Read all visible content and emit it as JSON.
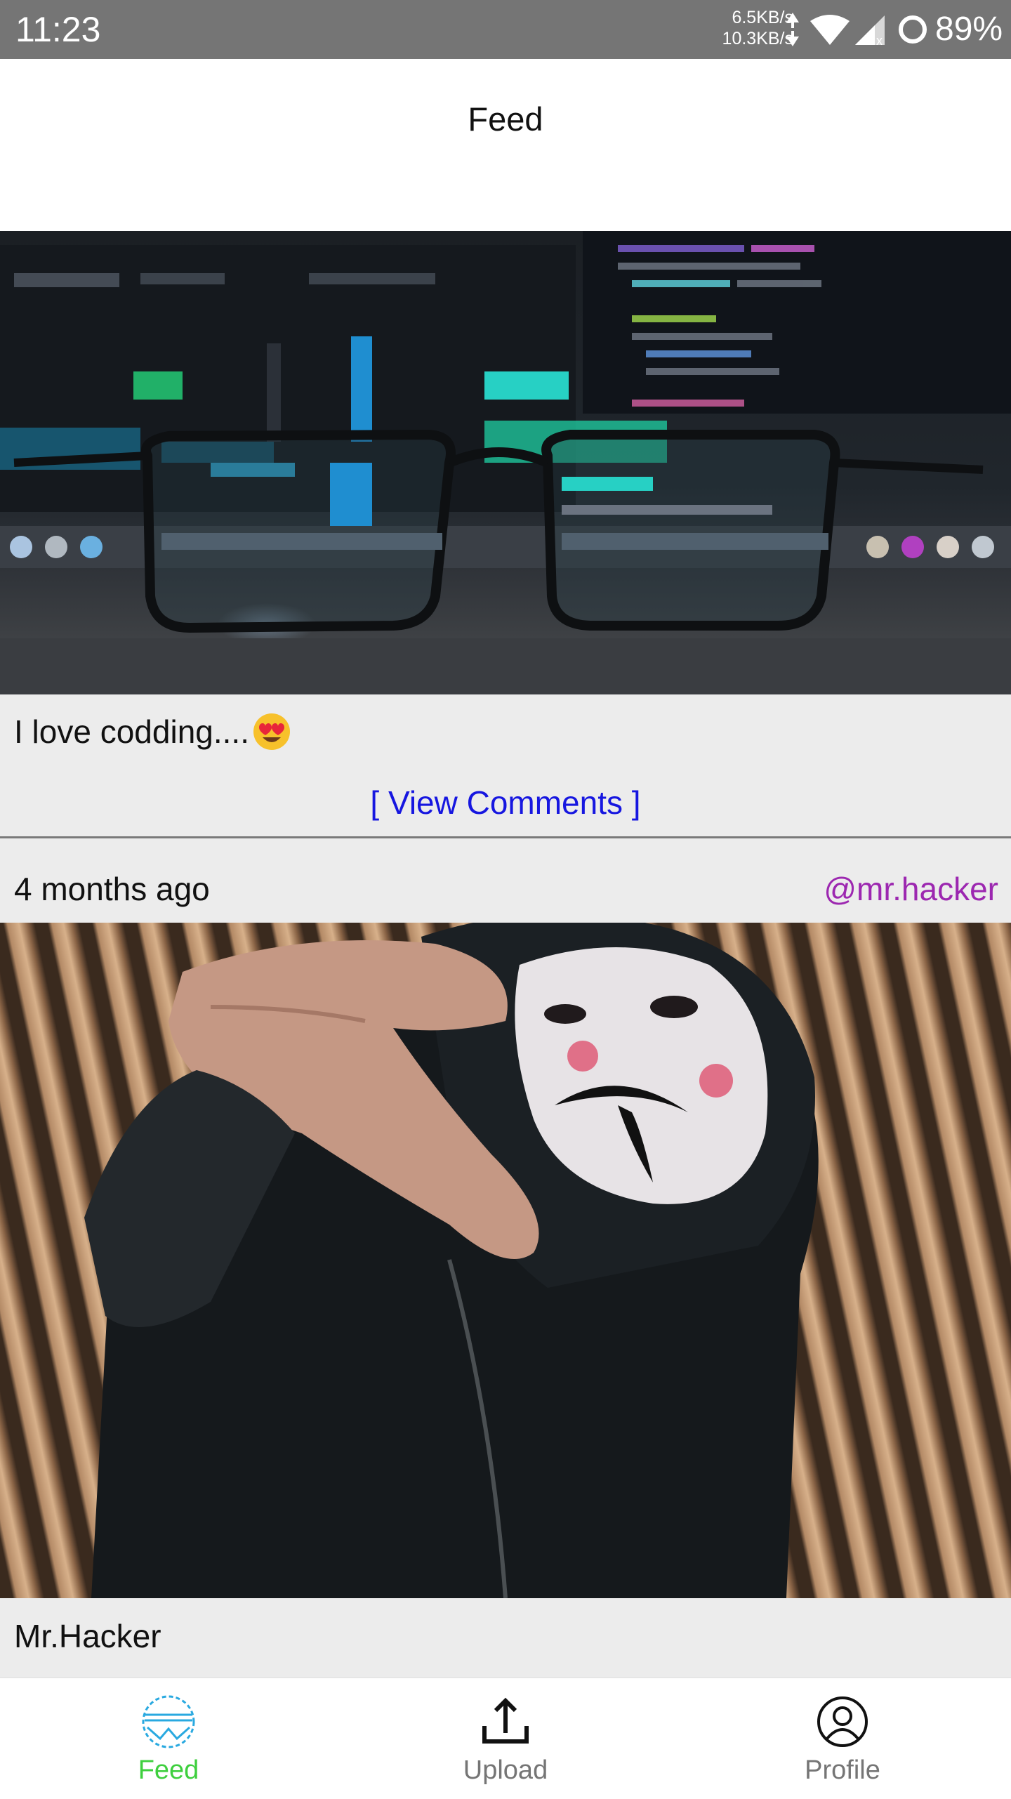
{
  "status_bar": {
    "time": "11:23",
    "net_down": "6.5KB/s",
    "net_up": "10.3KB/s",
    "battery": "89%"
  },
  "header": {
    "title": "Feed"
  },
  "posts": [
    {
      "image_desc": "eyeglasses in front of code monitor",
      "caption": "I love codding....",
      "emoji": "heart-eyes-emoji",
      "view_comments": "[ View Comments ]"
    },
    {
      "timestamp": "4 months ago",
      "username": "@mr.hacker",
      "image_desc": "person in mask reaching toward camera",
      "caption": "Mr.Hacker"
    }
  ],
  "bottom_nav": {
    "items": [
      {
        "label": "Feed",
        "icon": "feed-icon",
        "active": true
      },
      {
        "label": "Upload",
        "icon": "upload-icon",
        "active": false
      },
      {
        "label": "Profile",
        "icon": "profile-icon",
        "active": false
      }
    ]
  },
  "colors": {
    "status_bar": "#757575",
    "link": "#1616e0",
    "username": "#9c27b0",
    "active_nav": "#3ecf3e",
    "caption_band": "#ececec"
  }
}
